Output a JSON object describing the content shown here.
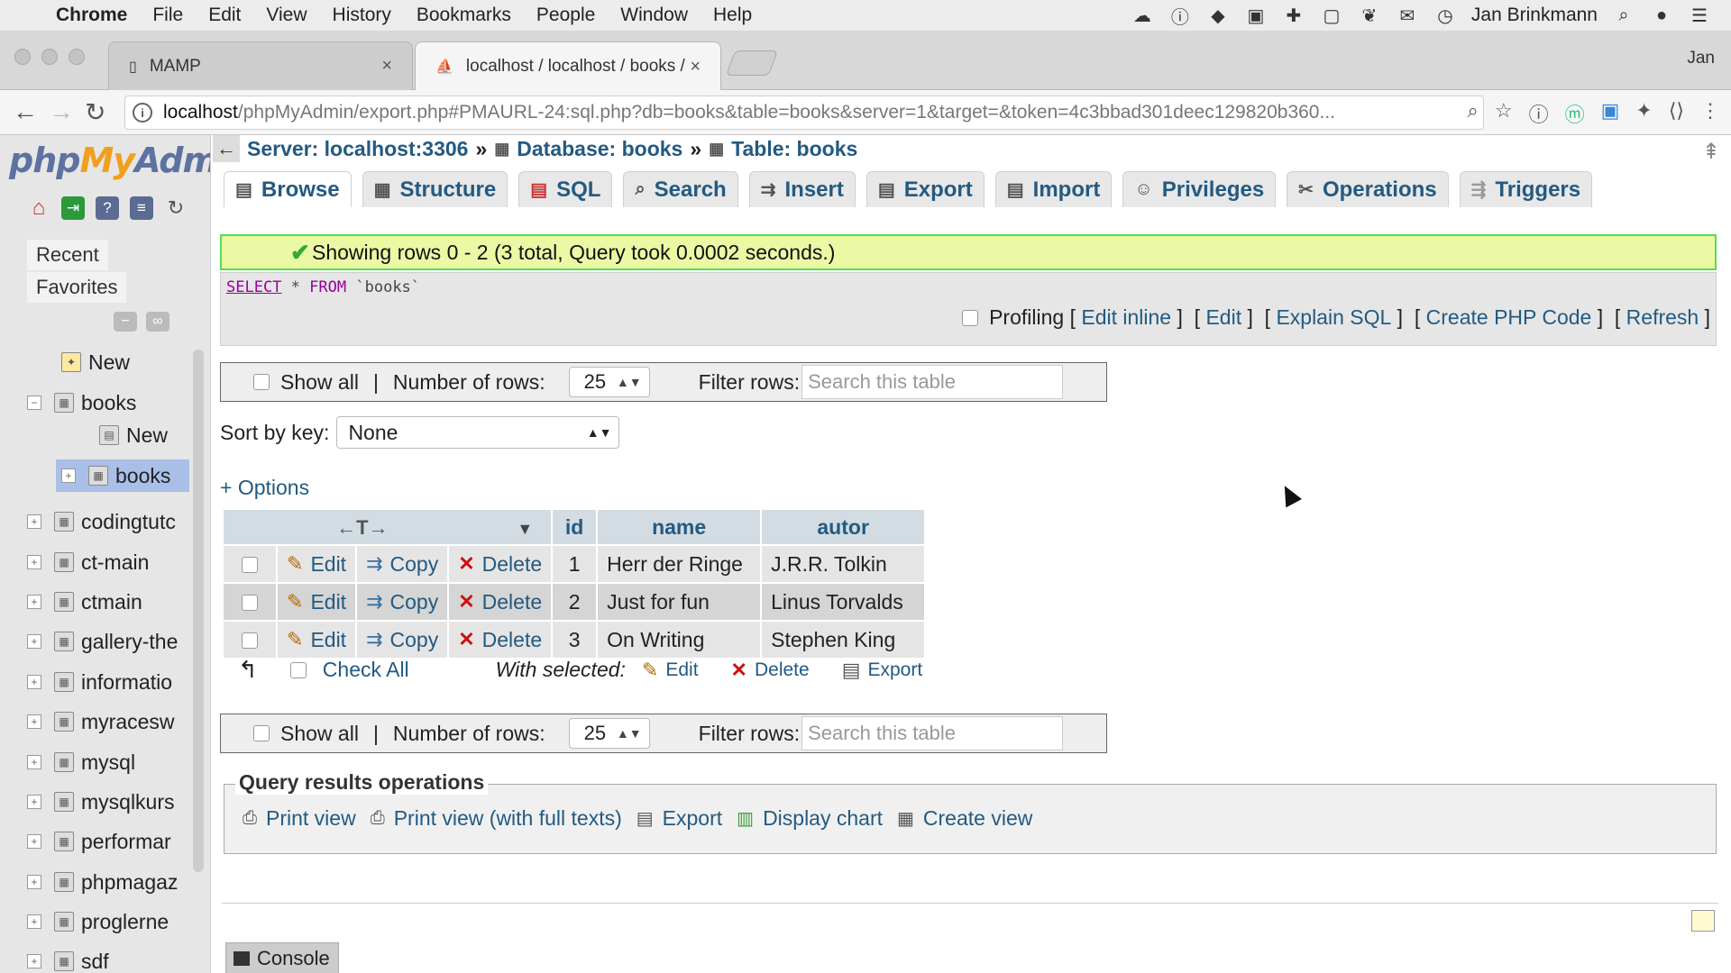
{
  "menubar": {
    "app": "Chrome",
    "items": [
      "File",
      "Edit",
      "View",
      "History",
      "Bookmarks",
      "People",
      "Window",
      "Help"
    ],
    "user": "Jan Brinkmann"
  },
  "browser": {
    "tabs": [
      {
        "title": "MAMP"
      },
      {
        "title": "localhost / localhost / books / l"
      }
    ],
    "profile": "Jan",
    "url_host": "localhost",
    "url_rest": "/phpMyAdmin/export.php#PMAURL-24:sql.php?db=books&table=books&server=1&target=&token=4c3bbad301deec129820b360..."
  },
  "sidebar": {
    "logo_php": "php",
    "logo_my": "My",
    "logo_admin": "Admi",
    "recent": "Recent",
    "favorites": "Favorites",
    "tree": [
      {
        "label": "New"
      },
      {
        "label": "books"
      },
      {
        "label": "New"
      },
      {
        "label": "books"
      },
      {
        "label": "codingtutc"
      },
      {
        "label": "ct-main"
      },
      {
        "label": "ctmain"
      },
      {
        "label": "gallery-the"
      },
      {
        "label": "informatio"
      },
      {
        "label": "myracesw"
      },
      {
        "label": "mysql"
      },
      {
        "label": "mysqlkurs"
      },
      {
        "label": "performar"
      },
      {
        "label": "phpmagaz"
      },
      {
        "label": "proglerne"
      },
      {
        "label": "sdf"
      }
    ]
  },
  "breadcrumb": {
    "server": "Server: localhost:3306",
    "database": "Database: books",
    "table": "Table: books",
    "sep": "»"
  },
  "tabs": [
    "Browse",
    "Structure",
    "SQL",
    "Search",
    "Insert",
    "Export",
    "Import",
    "Privileges",
    "Operations",
    "Triggers"
  ],
  "success_message": "Showing rows 0 - 2 (3 total, Query took 0.0002 seconds.)",
  "sql": {
    "select": "SELECT",
    "star": "*",
    "from": "FROM",
    "table": "`books`"
  },
  "sql_links": {
    "profiling": "Profiling",
    "edit_inline": "Edit inline",
    "edit": "Edit",
    "explain": "Explain SQL",
    "php": "Create PHP Code",
    "refresh": "Refresh"
  },
  "nav": {
    "show_all": "Show all",
    "sep": "|",
    "rows_label": "Number of rows:",
    "rows_value": "25",
    "filter_label": "Filter rows:",
    "filter_placeholder": "Search this table"
  },
  "sort": {
    "label": "Sort by key:",
    "value": "None"
  },
  "options_link": "+ Options",
  "table": {
    "columns": [
      "id",
      "name",
      "autor"
    ],
    "nav_arrows": "←T→",
    "rows": [
      {
        "id": "1",
        "name": "Herr der Ringe",
        "autor": "J.R.R. Tolkin"
      },
      {
        "id": "2",
        "name": "Just for fun",
        "autor": "Linus Torvalds"
      },
      {
        "id": "3",
        "name": "On Writing",
        "autor": "Stephen King"
      }
    ],
    "actions": {
      "edit": "Edit",
      "copy": "Copy",
      "delete": "Delete"
    }
  },
  "with_selected": {
    "check_all": "Check All",
    "label": "With selected:",
    "edit": "Edit",
    "delete": "Delete",
    "export": "Export"
  },
  "query_ops": {
    "legend": "Query results operations",
    "print": "Print view",
    "print_full": "Print view (with full texts)",
    "export": "Export",
    "chart": "Display chart",
    "view": "Create view"
  },
  "console": "Console"
}
